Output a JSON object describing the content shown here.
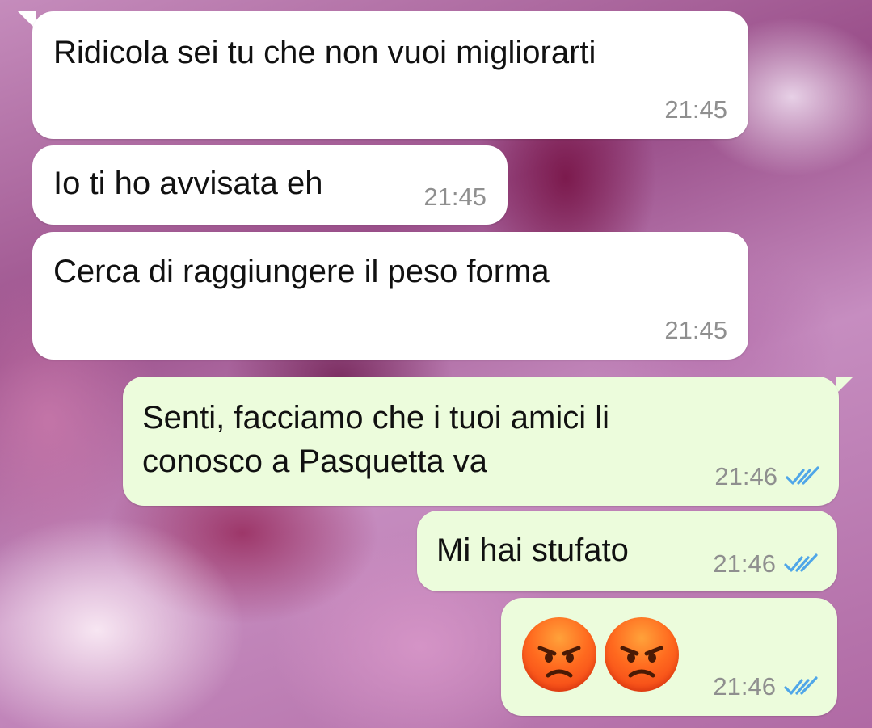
{
  "messages": [
    {
      "direction": "incoming",
      "text": "Ridicola sei tu che non vuoi migliorarti",
      "time": "21:45"
    },
    {
      "direction": "incoming",
      "text": "Io ti ho avvisata eh",
      "time": "21:45"
    },
    {
      "direction": "incoming",
      "text": "Cerca di raggiungere il peso forma",
      "time": "21:45"
    },
    {
      "direction": "outgoing",
      "text": "Senti, facciamo che i tuoi amici li\nconosco a Pasquetta va",
      "time": "21:46",
      "status": "read"
    },
    {
      "direction": "outgoing",
      "text": "Mi hai stufato",
      "time": "21:46",
      "status": "read"
    },
    {
      "direction": "outgoing",
      "emoji": [
        "angry-face-emoji",
        "angry-face-emoji"
      ],
      "time": "21:46",
      "status": "read"
    }
  ],
  "colors": {
    "incoming_bubble": "#ffffff",
    "outgoing_bubble": "#ecfcdc",
    "read_ticks": "#4fa6e8",
    "timestamp": "#8f8f8f"
  },
  "icons": {
    "read_receipt": "double-check-icon",
    "emoji": "angry-face-emoji",
    "background": "pink-magnolia-wallpaper"
  }
}
